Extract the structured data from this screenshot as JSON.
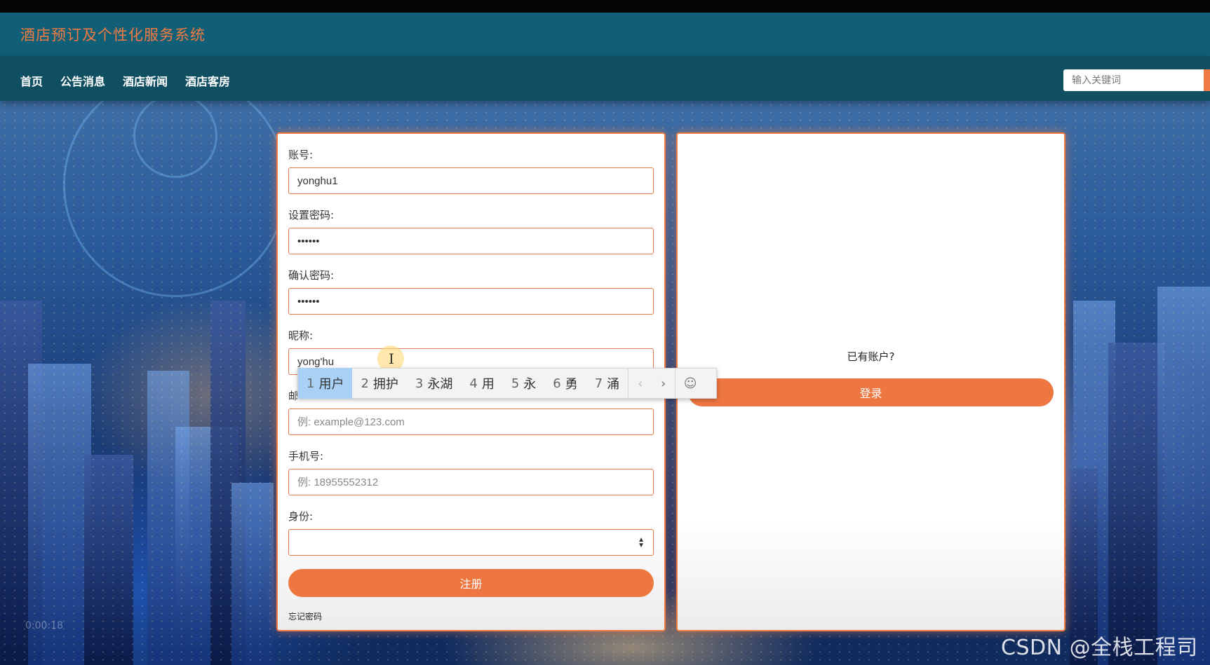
{
  "header": {
    "site_title": "酒店预订及个性化服务系统"
  },
  "nav": {
    "items": [
      {
        "label": "首页"
      },
      {
        "label": "公告消息"
      },
      {
        "label": "酒店新闻"
      },
      {
        "label": "酒店客房"
      }
    ],
    "search_placeholder": "输入关键词"
  },
  "register_form": {
    "account": {
      "label": "账号:",
      "value": "yonghu1"
    },
    "password": {
      "label": "设置密码:",
      "value": "••••••"
    },
    "confirm_password": {
      "label": "确认密码:",
      "value": "••••••"
    },
    "nickname": {
      "label": "昵称:",
      "value": "yong'hu"
    },
    "email": {
      "label": "邮",
      "placeholder": "例: example@123.com"
    },
    "phone": {
      "label": "手机号:",
      "placeholder": "例: 18955552312"
    },
    "role": {
      "label": "身份:",
      "value": ""
    },
    "submit_label": "注册",
    "forgot_label": "忘记密码"
  },
  "login_panel": {
    "prompt": "已有账户?",
    "login_label": "登录"
  },
  "ime": {
    "candidates": [
      {
        "num": "1",
        "text": "用户",
        "active": true
      },
      {
        "num": "2",
        "text": "拥护",
        "active": false
      },
      {
        "num": "3",
        "text": "永湖",
        "active": false
      },
      {
        "num": "4",
        "text": "用",
        "active": false
      },
      {
        "num": "5",
        "text": "永",
        "active": false
      },
      {
        "num": "6",
        "text": "勇",
        "active": false
      },
      {
        "num": "7",
        "text": "涌",
        "active": false
      }
    ],
    "prev_icon": "chevron-left-icon",
    "next_icon": "chevron-right-icon",
    "emoji_icon": "smiley-icon"
  },
  "overlay": {
    "timestamp": "0:00:18",
    "watermark": "CSDN @全栈工程司"
  },
  "colors": {
    "header_bg": "#115f77",
    "nav_bg": "#104f62",
    "accent": "#ee7640",
    "ime_active": "#a9d1f5"
  }
}
